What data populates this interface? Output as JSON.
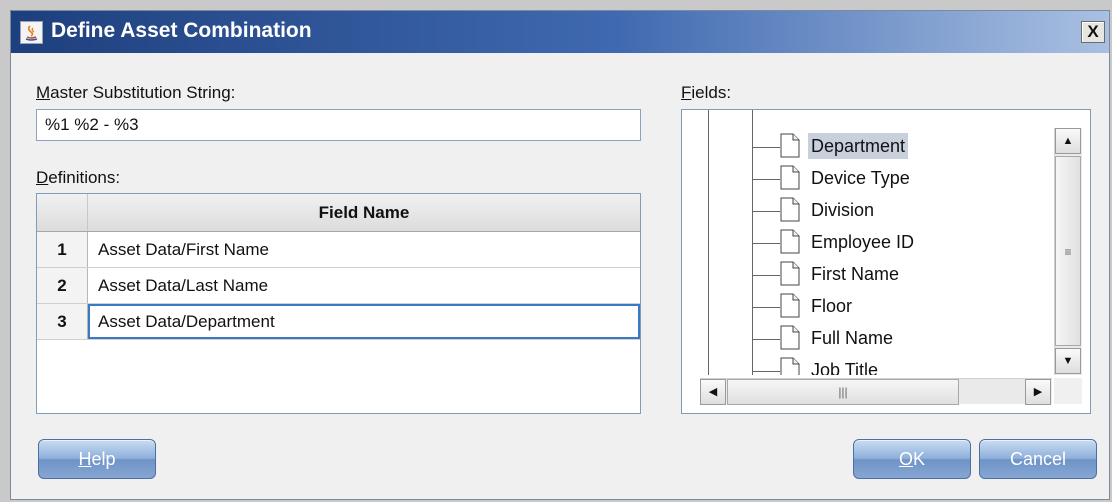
{
  "window": {
    "title": "Define Asset Combination",
    "close_label": "X",
    "icon": "java-app-icon"
  },
  "master": {
    "label_mnemonic": "M",
    "label_rest": "aster Substitution String:",
    "value": "%1 %2 - %3"
  },
  "definitions": {
    "label_mnemonic": "D",
    "label_rest": "efinitions:",
    "column_header": "Field Name",
    "rows": [
      {
        "num": "1",
        "value": "Asset Data/First Name"
      },
      {
        "num": "2",
        "value": "Asset Data/Last Name"
      },
      {
        "num": "3",
        "value": "Asset Data/Department"
      }
    ],
    "selected_row": "3"
  },
  "fields": {
    "label_mnemonic": "F",
    "label_rest": "ields:",
    "items": [
      {
        "label": "Department"
      },
      {
        "label": "Device Type"
      },
      {
        "label": "Division"
      },
      {
        "label": "Employee ID"
      },
      {
        "label": "First Name"
      },
      {
        "label": "Floor"
      },
      {
        "label": "Full Name"
      },
      {
        "label": "Job Title"
      }
    ],
    "selected_item": "Department"
  },
  "scrollbars": {
    "up_arrow": "▲",
    "down_arrow": "▼",
    "left_arrow": "◀",
    "right_arrow": "▶",
    "v_grip": "≡",
    "h_grip": "|||"
  },
  "buttons": {
    "help_mnemonic": "H",
    "help_rest": "elp",
    "ok_mnemonic": "O",
    "ok_rest": "K",
    "cancel": "Cancel"
  },
  "colors": {
    "title_gradient_start": "#1e3f7d",
    "title_gradient_end": "#a9c0e2",
    "button_blue": "#8fb0db",
    "selection_border": "#3b78c6",
    "tree_selection": "#c8d0dc"
  }
}
